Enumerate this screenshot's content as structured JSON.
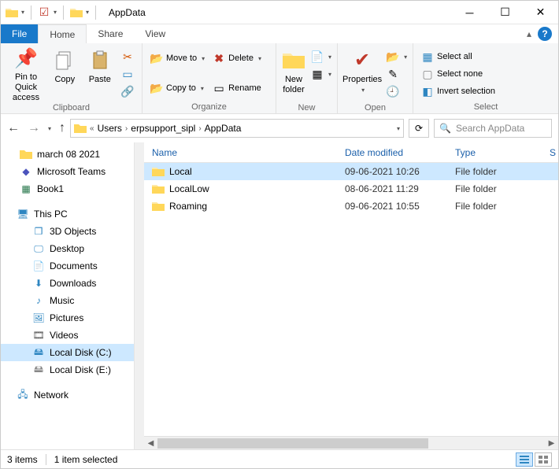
{
  "title": "AppData",
  "tabs": {
    "file": "File",
    "home": "Home",
    "share": "Share",
    "view": "View"
  },
  "ribbon": {
    "clipboard": {
      "label": "Clipboard",
      "pin": "Pin to Quick\naccess",
      "copy": "Copy",
      "paste": "Paste"
    },
    "organize": {
      "label": "Organize",
      "moveto": "Move to",
      "copyto": "Copy to",
      "delete": "Delete",
      "rename": "Rename"
    },
    "new": {
      "label": "New",
      "newfolder": "New\nfolder"
    },
    "open": {
      "label": "Open",
      "properties": "Properties"
    },
    "select": {
      "label": "Select",
      "selectall": "Select all",
      "selectnone": "Select none",
      "invert": "Invert selection"
    }
  },
  "breadcrumb": {
    "prefix": "«",
    "items": [
      "Users",
      "erpsupport_sipl",
      "AppData"
    ]
  },
  "search_placeholder": "Search AppData",
  "columns": {
    "name": "Name",
    "date": "Date modified",
    "type": "Type",
    "size": "S"
  },
  "sidebar": {
    "quick": [
      "march 08 2021",
      "Microsoft Teams",
      "Book1"
    ],
    "thispc": "This PC",
    "pcitems": [
      "3D Objects",
      "Desktop",
      "Documents",
      "Downloads",
      "Music",
      "Pictures",
      "Videos",
      "Local Disk (C:)",
      "Local Disk (E:)"
    ],
    "network": "Network"
  },
  "files": [
    {
      "name": "Local",
      "date": "09-06-2021 10:26",
      "type": "File folder",
      "selected": true
    },
    {
      "name": "LocalLow",
      "date": "08-06-2021 11:29",
      "type": "File folder",
      "selected": false
    },
    {
      "name": "Roaming",
      "date": "09-06-2021 10:55",
      "type": "File folder",
      "selected": false
    }
  ],
  "status": {
    "count": "3 items",
    "selected": "1 item selected"
  }
}
